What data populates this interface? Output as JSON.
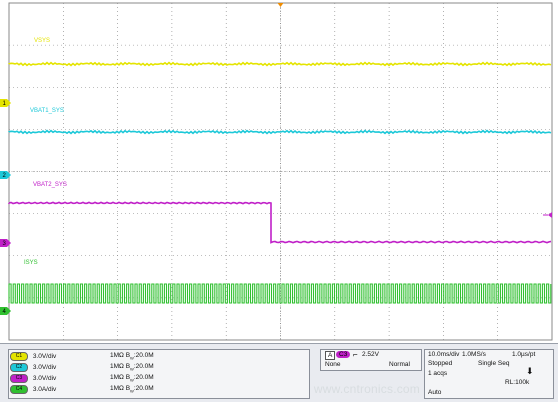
{
  "waveforms": [
    {
      "label": "VSYS",
      "color": "#e4e400",
      "marker": "1",
      "type": "flat"
    },
    {
      "label": "VBAT1_SYS",
      "color": "#1dc8d8",
      "marker": "2",
      "type": "flat"
    },
    {
      "label": "VBAT2_SYS",
      "color": "#c020c8",
      "marker": "3",
      "type": "step"
    },
    {
      "label": "ISYS",
      "color": "#30c030",
      "marker": "4",
      "type": "square"
    }
  ],
  "channels": [
    {
      "badge": "C1",
      "scale": "3.0V/div",
      "impedance": "1MΩ",
      "bandwidth": "B",
      "bw_sub": "W",
      "bw_val": ":20.0M",
      "color": "#e4e400"
    },
    {
      "badge": "C2",
      "scale": "3.0V/div",
      "impedance": "1MΩ",
      "bandwidth": "B",
      "bw_sub": "W",
      "bw_val": ":20.0M",
      "color": "#1dc8d8"
    },
    {
      "badge": "C3",
      "scale": "3.0V/div",
      "impedance": "1MΩ",
      "bandwidth": "B",
      "bw_sub": "W",
      "bw_val": ":20.0M",
      "color": "#c020c8"
    },
    {
      "badge": "C4",
      "scale": "3.0A/div",
      "impedance": "1MΩ",
      "bandwidth": "B",
      "bw_sub": "W",
      "bw_val": ":20.0M",
      "color": "#30c030"
    }
  ],
  "trigger": {
    "mode_letter": "A",
    "source": "C3",
    "level": "2.52V",
    "coupling": "None",
    "type": "Normal"
  },
  "acquisition": {
    "timebase": "10.0ms/div",
    "sample_rate": "1.0MS/s",
    "resolution": "1.0µs/pt",
    "state": "Stopped",
    "seq_mode": "Single Seq",
    "acqs": "1 acqs",
    "record_length": "RL:100k",
    "auto": "Auto"
  },
  "watermark": "www.cntronics.com",
  "colors": {
    "grid": "#7f7f7f",
    "trigger_marker": "#f08c00",
    "background": "#ffffff",
    "panel": "#e9ebf0"
  }
}
